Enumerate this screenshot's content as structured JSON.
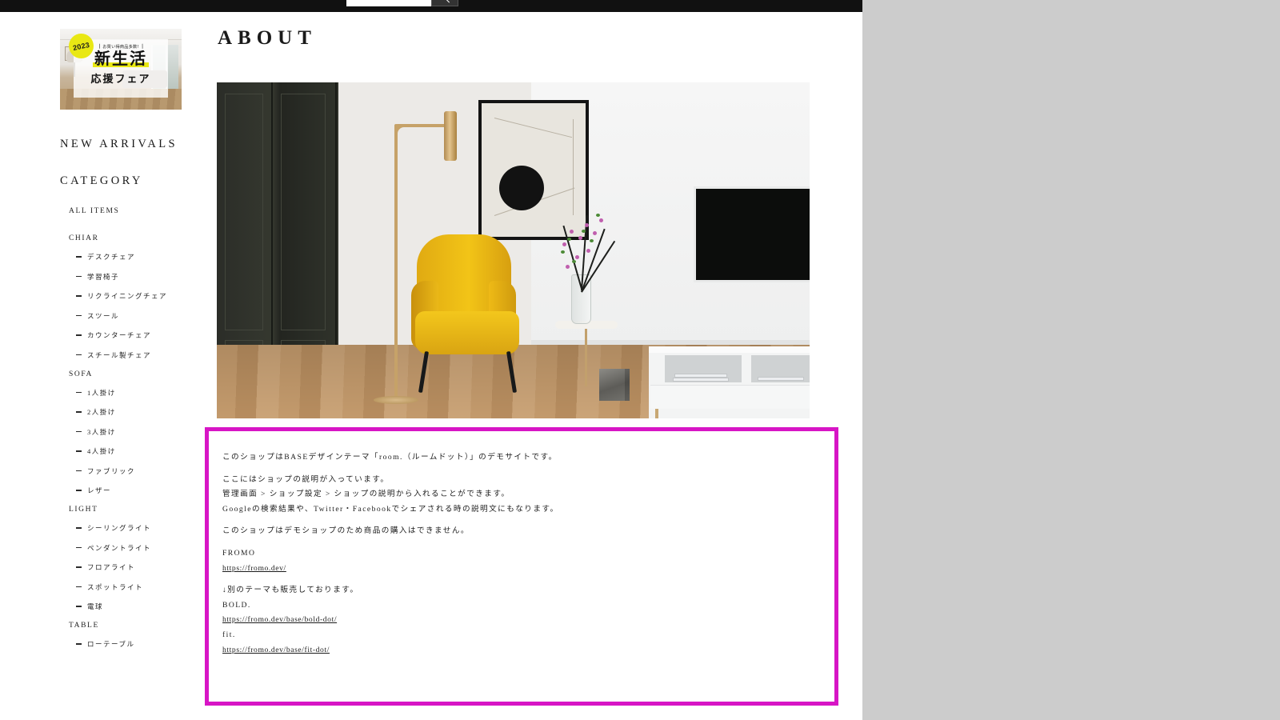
{
  "header": {
    "search": {
      "value": "",
      "placeholder": "",
      "button_icon": "search-icon"
    }
  },
  "sidebar": {
    "promo_banner": {
      "year": "2023",
      "kicker": "お買い得商品多数!",
      "title_line1": "新生活",
      "title_line2": "応援フェア",
      "accent_color": "#e9e814"
    },
    "nav": [
      {
        "label": "NEW ARRIVALS"
      },
      {
        "label": "CATEGORY"
      }
    ],
    "categories": [
      {
        "title": "ALL ITEMS",
        "items": []
      },
      {
        "title": "CHIAR",
        "items": [
          "デスクチェア",
          "学習椅子",
          "リクライニングチェア",
          "スツール",
          "カウンターチェア",
          "スチール製チェア"
        ]
      },
      {
        "title": "SOFA",
        "items": [
          "1人掛け",
          "2人掛け",
          "3人掛け",
          "4人掛け",
          "ファブリック",
          "レザー"
        ]
      },
      {
        "title": "LIGHT",
        "items": [
          "シーリングライト",
          "ペンダントライト",
          "フロアライト",
          "スポットライト",
          "電球"
        ]
      },
      {
        "title": "TABLE",
        "items": [
          "ローテーブル"
        ]
      }
    ]
  },
  "main": {
    "page_title": "ABOUT",
    "hero_image_alt": "living room with yellow armchair, floor lamp, framed art, vase and TV sideboard",
    "description": {
      "highlight_color": "#d715c5",
      "intro": "このショップはBASEデザインテーマ「room.（ルームドット）」のデモサイトです。",
      "para2_line1": "ここにはショップの説明が入っています。",
      "para2_line2": "管理画面 > ショップ設定 > ショップの説明から入れることができます。",
      "para2_line3": "Googleの検索結果や、Twitter・Facebookでシェアされる時の説明文にもなります。",
      "para3": "このショップはデモショップのため商品の購入はできません。",
      "brand_name": "FROMO",
      "brand_url": "https://fromo.dev/",
      "other_themes_note": "↓別のテーマも販売しております。",
      "theme1_name": "BOLD.",
      "theme1_url": "https://fromo.dev/base/bold-dot/",
      "theme2_name": "fit.",
      "theme2_url": "https://fromo.dev/base/fit-dot/"
    }
  }
}
